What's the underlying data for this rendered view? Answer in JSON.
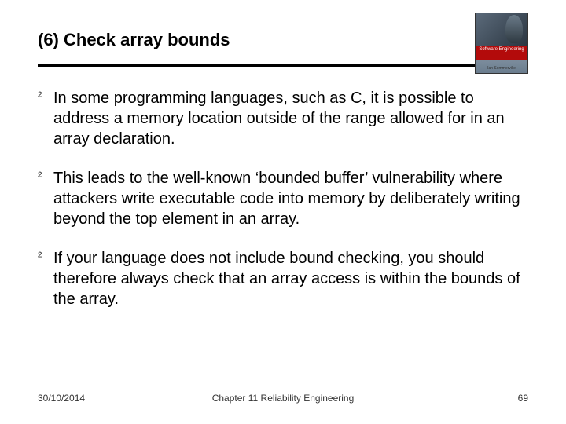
{
  "header": {
    "title": "(6) Check array bounds"
  },
  "book": {
    "stripe_line1": "Software Engineering",
    "author": "Ian Sommerville"
  },
  "bullets": [
    {
      "text": "In some programming languages, such as C, it is possible to address a memory location outside of the range allowed for in an array declaration."
    },
    {
      "text": "This leads to the well-known ‘bounded buffer’ vulnerability where attackers write executable code into memory by deliberately writing beyond the top element in an array."
    },
    {
      "text": "If your language does not include bound checking, you should therefore always check that an array access is within the bounds of the array."
    }
  ],
  "footer": {
    "date": "30/10/2014",
    "chapter": "Chapter 11 Reliability Engineering",
    "page": "69"
  },
  "bullet_symbol": "²"
}
